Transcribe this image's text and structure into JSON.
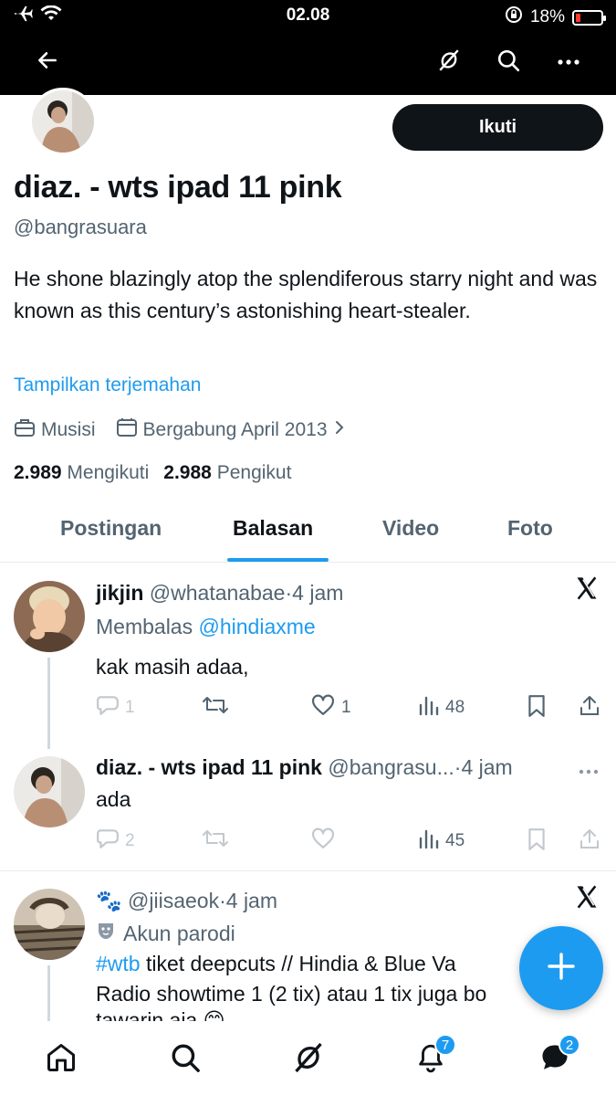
{
  "status_bar": {
    "time": "02.08",
    "battery": "18%",
    "battery_level": 0.18
  },
  "nav": {
    "back_icon": "arrow-left-icon",
    "grok_icon": "grok-icon",
    "search_icon": "search-icon",
    "more_icon": "more-icon"
  },
  "profile": {
    "name": "diaz. - wts ipad 11 pink",
    "handle": "@bangrasuara",
    "follow_label": "Ikuti",
    "bio": "He shone blazingly atop the splendiferous starry night and was known as this century’s astonishing heart-stealer.",
    "translate_label": "Tampilkan terjemahan",
    "category": "Musisi",
    "joined": "Bergabung April 2013",
    "following_count": "2.989",
    "following_label": "Mengikuti",
    "followers_count": "2.988",
    "followers_label": "Pengikut"
  },
  "tabs": [
    {
      "label": "Postingan"
    },
    {
      "label": "Balasan"
    },
    {
      "label": "Video"
    },
    {
      "label": "Foto"
    }
  ],
  "tweets": [
    {
      "name": "jikjin",
      "handle": "@whatanabae",
      "sep": "·",
      "time": "4 jam",
      "reply_prefix": "Membalas",
      "reply_to": "@hindiaxme",
      "text": "kak masih adaa,",
      "replies": "1",
      "retweets": "",
      "likes": "1",
      "views": "48"
    },
    {
      "name": "diaz. - wts ipad 11 pink",
      "handle": "@bangrasu...",
      "sep": "·",
      "time": "4 jam",
      "text": "ada",
      "replies": "2",
      "retweets": "",
      "likes": "",
      "views": "45"
    },
    {
      "name_emoji": "🐾",
      "handle": "@jiisaeok",
      "sep": "·",
      "time": "4 jam",
      "parody_label": "Akun parodi",
      "hashtag": "#wtb",
      "text1": " tiket deepcuts // Hindia & Blue Va",
      "text2": "Radio showtime 1 (2 tix) atau 1 tix juga bo",
      "text3": "tawarin aja 😊"
    }
  ],
  "bottom_nav": {
    "notifications_badge": "7",
    "messages_badge": "2"
  }
}
